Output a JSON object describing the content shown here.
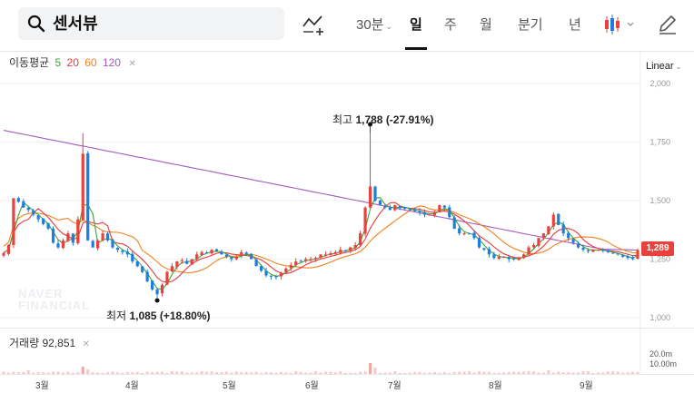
{
  "toolbar": {
    "stock_name": "센서뷰",
    "interval_label": "30분",
    "tabs": [
      "일",
      "주",
      "월",
      "분기",
      "년"
    ],
    "active_tab": "일"
  },
  "chart": {
    "ma_legend": {
      "title": "이동평균",
      "periods": [
        {
          "label": "5",
          "color": "#3fa535"
        },
        {
          "label": "20",
          "color": "#e6393a"
        },
        {
          "label": "60",
          "color": "#f0821e"
        },
        {
          "label": "120",
          "color": "#a55cc3"
        }
      ]
    },
    "scale_mode": "Linear",
    "price_axis": [
      "2,000",
      "1,750",
      "1,500",
      "1,250",
      "1,000"
    ],
    "current_price": "1,289",
    "high_annotation": {
      "label": "최고",
      "value": "1,788",
      "change": "(-27.91%)"
    },
    "low_annotation": {
      "label": "최저",
      "value": "1,085",
      "change": "(+18.80%)"
    },
    "watermark": [
      "NAVER",
      "FINANCIAL"
    ],
    "up_color": "#e8413e",
    "down_color": "#1c7fe0"
  },
  "volume": {
    "title": "거래량",
    "value": "92,851",
    "axis": [
      "20.0m",
      "10.00m"
    ]
  },
  "x_axis": {
    "months": [
      "3월",
      "4월",
      "5월",
      "6월",
      "7월",
      "8월",
      "9월"
    ]
  },
  "chart_data": {
    "type": "candlestick",
    "ylim": [
      1000,
      2000
    ],
    "x_labels": [
      "3월",
      "4월",
      "5월",
      "6월",
      "7월",
      "8월",
      "9월"
    ],
    "high": {
      "value": 1788,
      "label": "최고 1,788 (-27.91%)"
    },
    "low": {
      "value": 1085,
      "label": "최저 1,085 (+18.80%)"
    },
    "last_close": 1289,
    "close_series": [
      1275,
      1310,
      1510,
      1495,
      1470,
      1460,
      1440,
      1420,
      1400,
      1380,
      1320,
      1300,
      1330,
      1360,
      1320,
      1420,
      1700,
      1330,
      1300,
      1330,
      1360,
      1330,
      1300,
      1290,
      1280,
      1270,
      1240,
      1220,
      1195,
      1155,
      1120,
      1100,
      1140,
      1195,
      1220,
      1240,
      1245,
      1230,
      1250,
      1270,
      1280,
      1275,
      1290,
      1285,
      1270,
      1260,
      1250,
      1260,
      1280,
      1270,
      1250,
      1220,
      1200,
      1180,
      1175,
      1175,
      1190,
      1210,
      1225,
      1240,
      1240,
      1250,
      1250,
      1255,
      1270,
      1270,
      1275,
      1280,
      1290,
      1285,
      1300,
      1310,
      1360,
      1470,
      1560,
      1500,
      1480,
      1470,
      1460,
      1480,
      1470,
      1465,
      1460,
      1455,
      1450,
      1440,
      1440,
      1450,
      1480,
      1470,
      1430,
      1380,
      1360,
      1360,
      1360,
      1340,
      1300,
      1290,
      1270,
      1255,
      1260,
      1260,
      1250,
      1250,
      1255,
      1270,
      1300,
      1310,
      1340,
      1360,
      1390,
      1440,
      1395,
      1360,
      1340,
      1320,
      1300,
      1290,
      1285,
      1290,
      1290,
      1285,
      1280,
      1275,
      1270,
      1260,
      1255,
      1250,
      1289
    ]
  }
}
